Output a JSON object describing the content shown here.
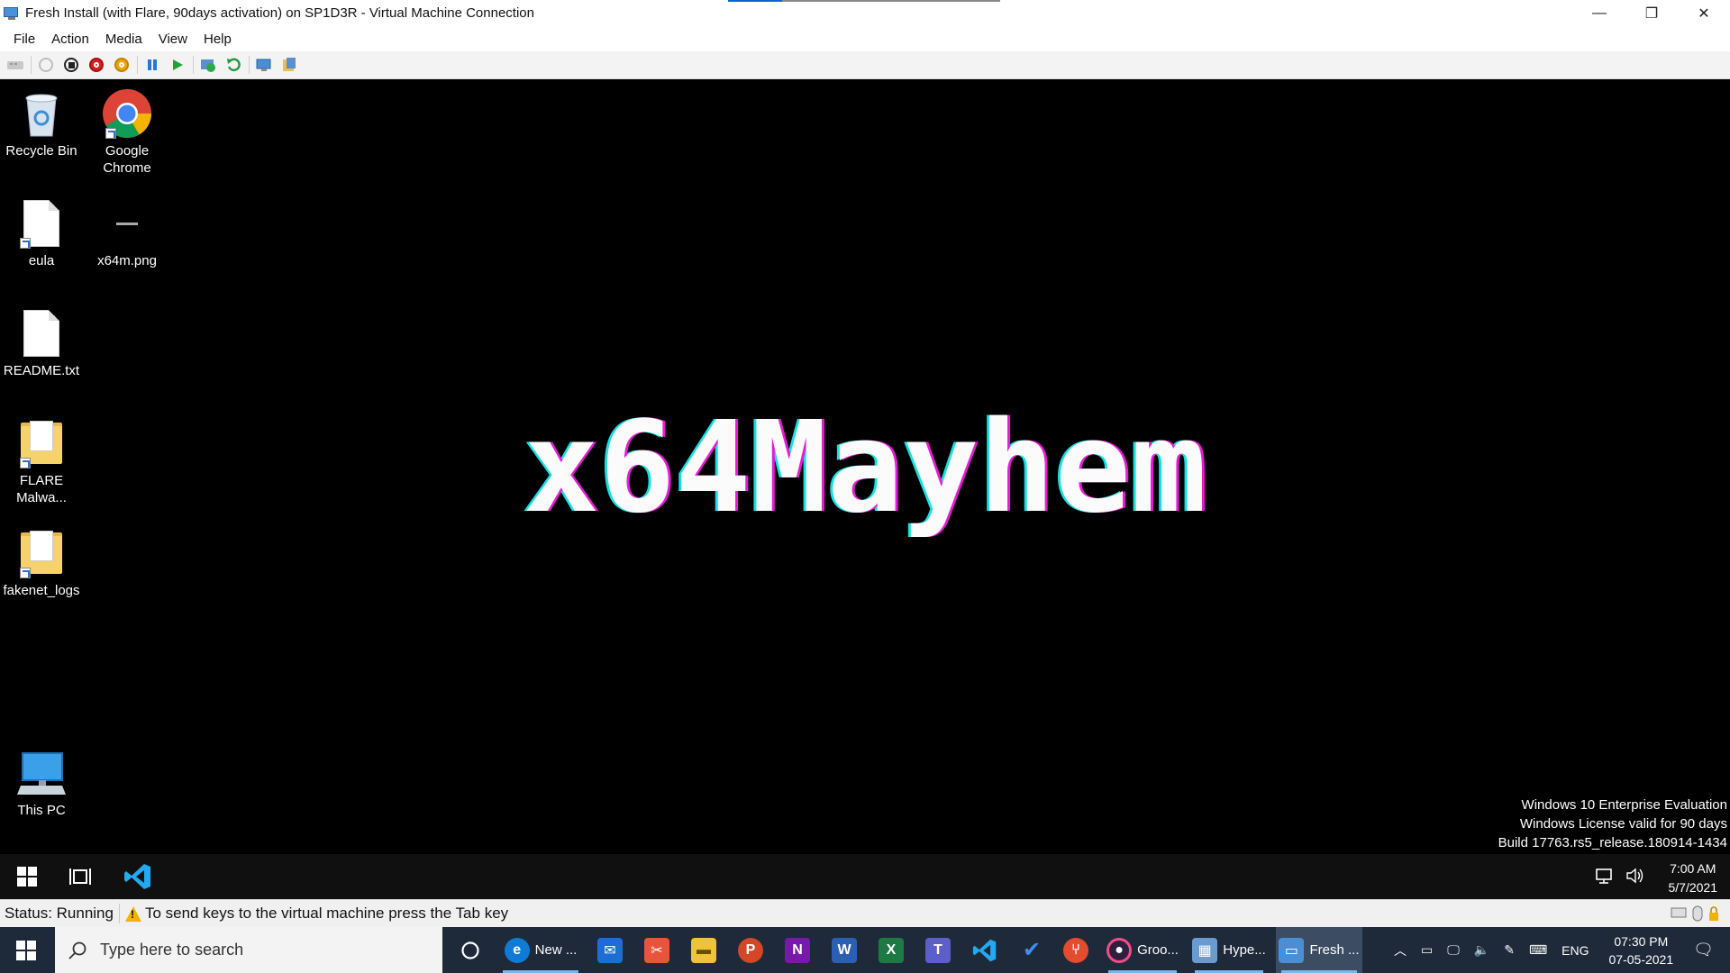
{
  "window": {
    "title": "Fresh Install (with Flare, 90days activation) on SP1D3R - Virtual Machine Connection",
    "controls": {
      "minimize": "—",
      "restore": "❐",
      "close": "✕"
    }
  },
  "menu": [
    "File",
    "Action",
    "Media",
    "View",
    "Help"
  ],
  "toolbar": {
    "icons": [
      "ctrl-alt-del-icon",
      "start-icon",
      "turn-off-icon",
      "shut-down-icon",
      "power-icon",
      "pause-icon",
      "resume-icon",
      "checkpoint-icon",
      "revert-icon",
      "enhanced-session-icon",
      "share-icon"
    ]
  },
  "desktop": {
    "icons": [
      {
        "label": "Recycle Bin"
      },
      {
        "label": "Google Chrome"
      },
      {
        "label": "eula"
      },
      {
        "label": "x64m.png"
      },
      {
        "label": "README.txt"
      },
      {
        "label": "FLARE Malwa..."
      },
      {
        "label": "fakenet_logs"
      },
      {
        "label": "This PC"
      }
    ],
    "logo_text": "x64Mayhem",
    "logo_colors": {
      "main": "#fbfbfb",
      "cyan": "#18e0e0",
      "magenta": "#e81ad8"
    },
    "watermark": {
      "line1": "Windows 10 Enterprise Evaluation",
      "line2": "Windows License valid for 90 days",
      "line3": "Build 17763.rs5_release.180914-1434"
    }
  },
  "vm_taskbar": {
    "pinned": [
      "start-icon",
      "task-view-icon",
      "vscode-icon"
    ],
    "clock_time": "7:00 AM",
    "clock_date": "5/7/2021"
  },
  "statusbar": {
    "status": "Status: Running",
    "message": "To send keys to the virtual machine press the Tab key"
  },
  "host_taskbar": {
    "search_placeholder": "Type here to search",
    "apps": [
      {
        "name": "edge",
        "label": "New ..."
      },
      {
        "name": "mail",
        "label": ""
      },
      {
        "name": "snip",
        "label": ""
      },
      {
        "name": "explorer",
        "label": ""
      },
      {
        "name": "powerpoint",
        "label": ""
      },
      {
        "name": "onenote",
        "label": ""
      },
      {
        "name": "word",
        "label": ""
      },
      {
        "name": "excel",
        "label": ""
      },
      {
        "name": "teams",
        "label": ""
      },
      {
        "name": "vscode",
        "label": ""
      },
      {
        "name": "todo",
        "label": ""
      },
      {
        "name": "git",
        "label": ""
      },
      {
        "name": "groove",
        "label": "Groo..."
      },
      {
        "name": "hyperv",
        "label": "Hype..."
      },
      {
        "name": "vmconnect",
        "label": "Fresh ..."
      }
    ],
    "language": "ENG",
    "clock_time": "07:30 PM",
    "clock_date": "07-05-2021"
  }
}
